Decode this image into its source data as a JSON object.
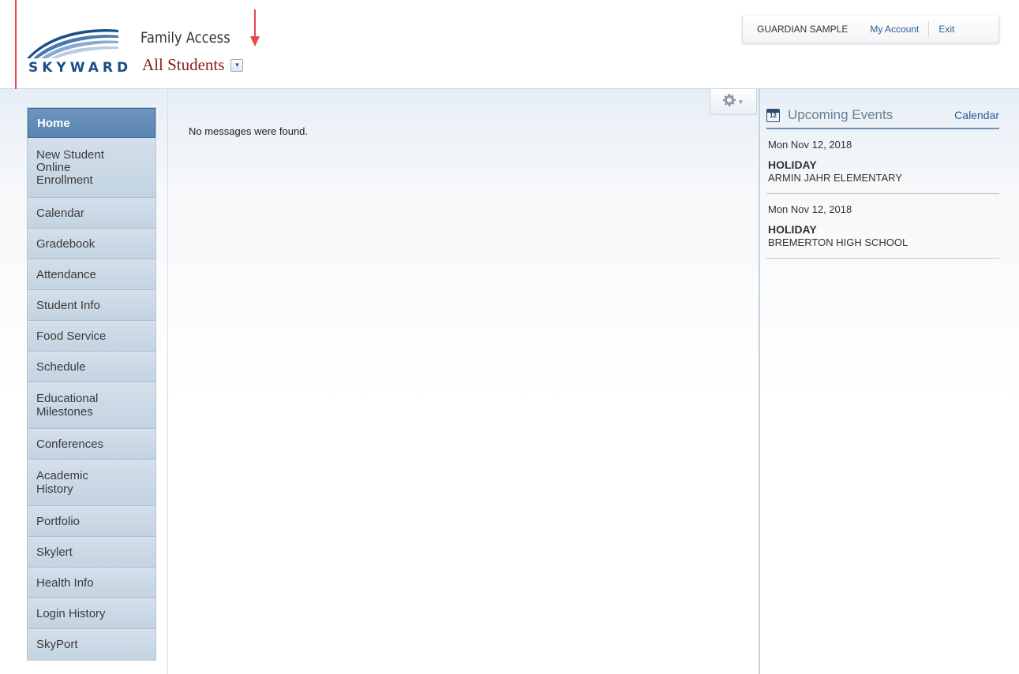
{
  "header": {
    "logo_text": "SKYWARD",
    "app_name": "Family Access",
    "student_selector": "All Students"
  },
  "userbar": {
    "user_name": "GUARDIAN SAMPLE",
    "my_account": "My Account",
    "exit": "Exit"
  },
  "sidebar": {
    "items": [
      {
        "label": "Home"
      },
      {
        "label": "New Student Online Enrollment"
      },
      {
        "label": "Calendar"
      },
      {
        "label": "Gradebook"
      },
      {
        "label": "Attendance"
      },
      {
        "label": "Student Info"
      },
      {
        "label": "Food Service"
      },
      {
        "label": "Schedule"
      },
      {
        "label": "Educational Milestones"
      },
      {
        "label": "Conferences"
      },
      {
        "label": "Academic History"
      },
      {
        "label": "Portfolio"
      },
      {
        "label": "Skylert"
      },
      {
        "label": "Health Info"
      },
      {
        "label": "Login History"
      },
      {
        "label": "SkyPort"
      }
    ]
  },
  "main": {
    "message": "No messages were found."
  },
  "events": {
    "title": "Upcoming Events",
    "calendar_link": "Calendar",
    "items": [
      {
        "date": "Mon Nov 12, 2018",
        "title": "HOLIDAY",
        "location": "ARMIN JAHR ELEMENTARY"
      },
      {
        "date": "Mon Nov 12, 2018",
        "title": "HOLIDAY",
        "location": "BREMERTON HIGH SCHOOL"
      }
    ]
  },
  "colors": {
    "accent": "#2a5b93",
    "active_nav": "#5a84b2",
    "annotation_arrow": "#e8474c",
    "student_name": "#8a1c1c"
  }
}
